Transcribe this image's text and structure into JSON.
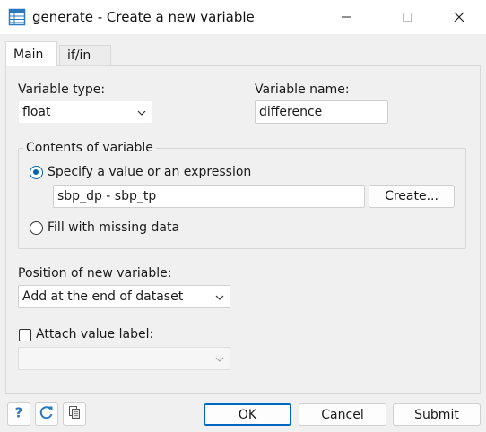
{
  "window": {
    "title": "generate - Create a new variable",
    "icon": "table-icon"
  },
  "tabs": [
    {
      "label": "Main",
      "selected": true
    },
    {
      "label": "if/in",
      "selected": false
    }
  ],
  "main": {
    "variable_type_label": "Variable type:",
    "variable_type_value": "float",
    "variable_name_label": "Variable name:",
    "variable_name_value": "difference",
    "contents_group_label": "Contents of variable",
    "specify_option_label": "Specify a value or an expression",
    "expression_value": "sbp_dp - sbp_tp",
    "create_button_label": "Create...",
    "fill_missing_label": "Fill with missing data",
    "position_label": "Position of new variable:",
    "position_value": "Add at the end of dataset",
    "attach_label": "Attach value label:",
    "attach_value": ""
  },
  "footer": {
    "ok_label": "OK",
    "cancel_label": "Cancel",
    "submit_label": "Submit"
  },
  "colors": {
    "accent": "#0063b1",
    "icon_blue": "#2b79c2"
  }
}
